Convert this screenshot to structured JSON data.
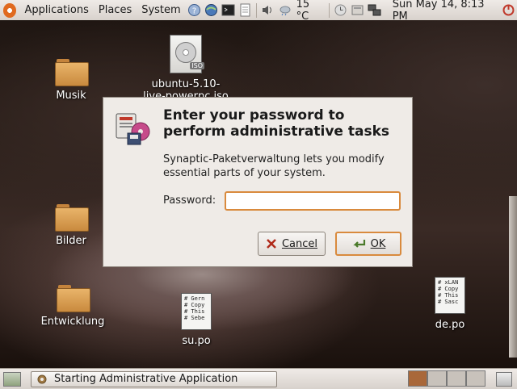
{
  "top_panel": {
    "menus": [
      "Applications",
      "Places",
      "System"
    ],
    "temperature": "15 °C",
    "clock": "Sun May 14,  8:13 PM"
  },
  "desktop_icons": [
    {
      "label": "Musik"
    },
    {
      "label": "ubuntu-5.10-live-powerpc.iso"
    },
    {
      "label": "Bilder"
    },
    {
      "label": "Entwicklung"
    },
    {
      "label": "su.po",
      "preview": "# Gern\n# Copy\n# This\n# Sebe"
    },
    {
      "label": "de.po",
      "preview": "# xLAN\n# Copy\n# This\n# Sasc"
    }
  ],
  "dialog": {
    "title": "Enter your password to perform administrative tasks",
    "message": "Synaptic-Paketverwaltung lets you modify essential parts of your system.",
    "password_label": "Password:",
    "password_value": "",
    "cancel_label": "Cancel",
    "ok_label": "OK"
  },
  "bottom_panel": {
    "task_label": "Starting Administrative Application"
  },
  "colors": {
    "accent": "#d98a3d",
    "panel": "#e6e1dc",
    "workspace_active": "#a9683a"
  }
}
